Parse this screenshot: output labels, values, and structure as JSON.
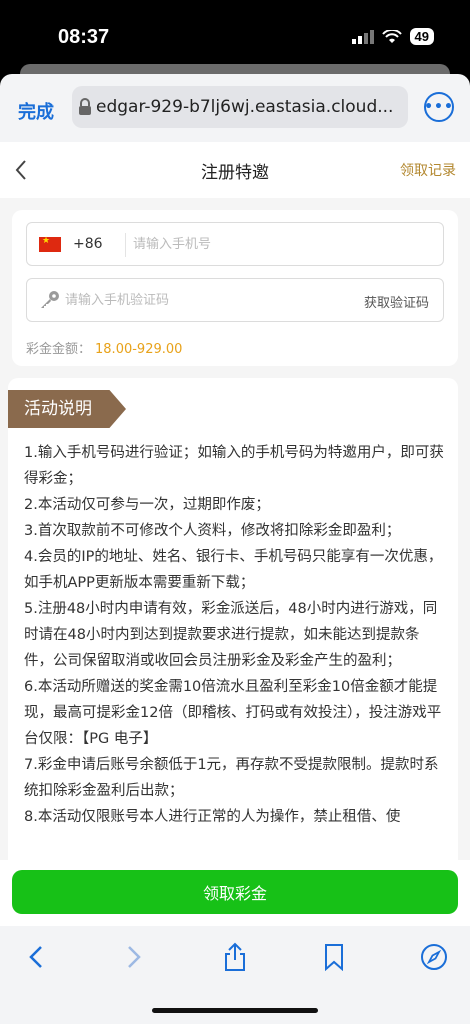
{
  "status": {
    "time": "08:37",
    "battery": "49"
  },
  "browser": {
    "done_label": "完成",
    "url": "edgar-929-b7lj6wj.eastasia.cloud..."
  },
  "nav": {
    "title": "注册特邀",
    "record_label": "领取记录"
  },
  "form": {
    "country_code": "+86",
    "phone_placeholder": "请输入手机号",
    "code_placeholder": "请输入手机验证码",
    "get_code_label": "获取验证码",
    "bonus_label": "彩金金额：",
    "bonus_value": "18.00-929.00"
  },
  "activity": {
    "title": "活动说明",
    "rules": [
      "1.输入手机号码进行验证；如输入的手机号码为特邀用户，即可获得彩金；",
      "2.本活动仅可参与一次，过期即作废；",
      "3.首次取款前不可修改个人资料，修改将扣除彩金即盈利；",
      "4.会员的IP的地址、姓名、银行卡、手机号码只能享有一次优惠，如手机APP更新版本需要重新下载；",
      "5.注册48小时内申请有效，彩金派送后，48小时内进行游戏，同时请在48小时内到达到提款要求进行提款，如未能达到提款条件，公司保留取消或收回会员注册彩金及彩金产生的盈利；",
      "6.本活动所赠送的奖金需10倍流水且盈利至彩金10倍金额才能提现，最高可提彩金12倍（即稽核、打码或有效投注），投注游戏平台仅限：【PG 电子】",
      "7.彩金申请后账号余额低于1元，再存款不受提款限制。提款时系统扣除彩金盈利后出款；",
      "8.本活动仅限账号本人进行正常的人为操作，禁止租借、使"
    ]
  },
  "claim_button": "领取彩金",
  "colors": {
    "accent_blue": "#1a6ed8",
    "gold": "#b38830",
    "bonus": "#e8a21a",
    "ribbon": "#8a6a4d",
    "claim_green": "#17c117"
  },
  "icons": {
    "toolbar": [
      "back-icon",
      "forward-icon",
      "share-icon",
      "bookmarks-icon",
      "compass-icon"
    ]
  }
}
